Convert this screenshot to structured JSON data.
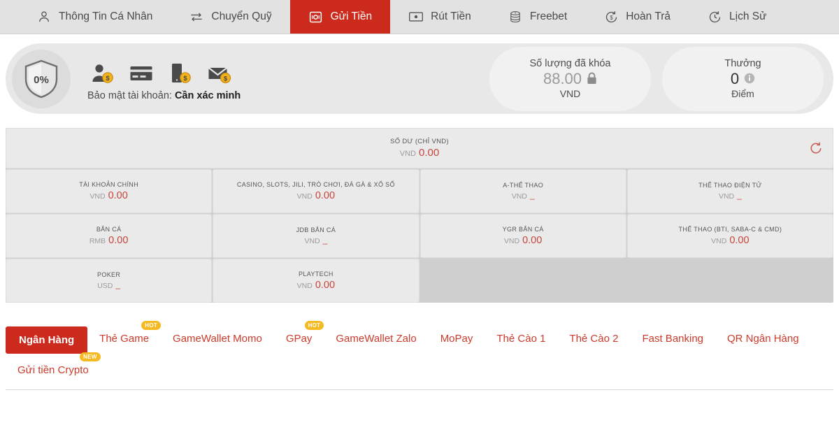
{
  "nav": {
    "items": [
      {
        "label": "Thông Tin Cá Nhân",
        "icon": "user-icon",
        "active": false
      },
      {
        "label": "Chuyển Quỹ",
        "icon": "transfer-icon",
        "active": false
      },
      {
        "label": "Gửi Tiền",
        "icon": "deposit-icon",
        "active": true
      },
      {
        "label": "Rút Tiền",
        "icon": "withdraw-icon",
        "active": false
      },
      {
        "label": "Freebet",
        "icon": "coins-icon",
        "active": false
      },
      {
        "label": "Hoàn Trả",
        "icon": "rebate-icon",
        "active": false
      },
      {
        "label": "Lịch Sử",
        "icon": "history-icon",
        "active": false
      }
    ]
  },
  "account": {
    "security_percent": "0%",
    "security_label": "Bảo mật tài khoản:",
    "security_status": "Cần xác minh",
    "verify_icons": [
      {
        "name": "personal-verify-icon",
        "badge": "$"
      },
      {
        "name": "bank-card-verify-icon",
        "badge": ""
      },
      {
        "name": "phone-verify-icon",
        "badge": "$"
      },
      {
        "name": "email-verify-icon",
        "badge": "$"
      }
    ],
    "locked": {
      "title": "Số lượng đã khóa",
      "value": "88.00",
      "unit": "VND",
      "icon": "lock-icon"
    },
    "bonus": {
      "title": "Thưởng",
      "value": "0",
      "unit": "Điểm",
      "icon": "info-icon"
    }
  },
  "balance": {
    "total_label": "SỐ DƯ (CHỈ VND)",
    "total_currency": "VND",
    "total_amount": "0.00",
    "refresh_icon": "refresh-icon",
    "wallets": [
      {
        "name": "TÀI KHOẢN CHÍNH",
        "currency": "VND",
        "amount": "0.00"
      },
      {
        "name": "CASINO, SLOTS, JILI, TRÒ CHƠI, ĐÁ GÀ & XỔ SỐ",
        "currency": "VND",
        "amount": "0.00"
      },
      {
        "name": "A-THỂ THAO",
        "currency": "VND",
        "amount": "_"
      },
      {
        "name": "THỂ THAO ĐIỆN TỬ",
        "currency": "VND",
        "amount": "_"
      },
      {
        "name": "BẮN CÁ",
        "currency": "RMB",
        "amount": "0.00"
      },
      {
        "name": "JDB BẮN CÁ",
        "currency": "VND",
        "amount": "_"
      },
      {
        "name": "YGR BẮN CÁ",
        "currency": "VND",
        "amount": "0.00"
      },
      {
        "name": "THỂ THAO (BTI, SABA-C & CMD)",
        "currency": "VND",
        "amount": "0.00"
      },
      {
        "name": "POKER",
        "currency": "USD",
        "amount": "_"
      },
      {
        "name": "PLAYTECH",
        "currency": "VND",
        "amount": "0.00"
      }
    ]
  },
  "payment": {
    "tabs": [
      {
        "label": "Ngân Hàng",
        "badge": "",
        "active": true
      },
      {
        "label": "Thẻ Game",
        "badge": "HOT",
        "active": false
      },
      {
        "label": "GameWallet Momo",
        "badge": "",
        "active": false
      },
      {
        "label": "GPay",
        "badge": "HOT",
        "active": false
      },
      {
        "label": "GameWallet Zalo",
        "badge": "",
        "active": false
      },
      {
        "label": "MoPay",
        "badge": "",
        "active": false
      },
      {
        "label": "Thẻ Cào 1",
        "badge": "",
        "active": false
      },
      {
        "label": "Thẻ Cào 2",
        "badge": "",
        "active": false
      },
      {
        "label": "Fast Banking",
        "badge": "",
        "active": false
      },
      {
        "label": "QR Ngân Hàng",
        "badge": "",
        "active": false
      },
      {
        "label": "Gửi tiền Crypto",
        "badge": "NEW",
        "active": false
      }
    ]
  },
  "colors": {
    "brand_red": "#cc2a1c",
    "link_red": "#cc3b2b",
    "amount_red": "#c8453c",
    "badge_yellow": "#f5b921",
    "nav_bg": "#e2e2e2",
    "panel_bg": "#e8e8e8"
  }
}
